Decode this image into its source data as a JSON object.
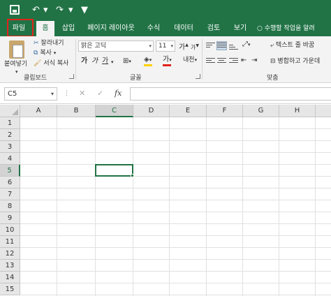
{
  "quick_access": {
    "save_icon": "save-icon",
    "undo_icon": "undo-icon",
    "redo_icon": "redo-icon",
    "undo_glyph": "↶",
    "redo_glyph": "↷",
    "dropdown_glyph": "▾",
    "customize_glyph": "▼"
  },
  "tabs": [
    {
      "label": "파일",
      "active": false
    },
    {
      "label": "홈",
      "active": true
    },
    {
      "label": "삽입",
      "active": false
    },
    {
      "label": "페이지 레이아웃",
      "active": false
    },
    {
      "label": "수식",
      "active": false
    },
    {
      "label": "데이터",
      "active": false
    },
    {
      "label": "검토",
      "active": false
    },
    {
      "label": "보기",
      "active": false
    }
  ],
  "tell_me": {
    "icon": "lightbulb-icon",
    "glyph": "💡",
    "placeholder": "수행할 작업을 알려"
  },
  "ribbon": {
    "clipboard": {
      "paste_label": "붙여넣기",
      "cut_label": "잘라내기",
      "copy_label": "복사",
      "copy_dropdown": "▾",
      "format_painter_label": "서식 복사",
      "group_label": "클립보드"
    },
    "font": {
      "font_name": "맑은 고딕",
      "font_size": "11",
      "grow_label": "가",
      "shrink_label": "가",
      "bold_label": "가",
      "italic_label": "가",
      "underline_label": "가",
      "font_color_label": "가",
      "phonetic_label": "내천",
      "fill_color": "#ffd200",
      "font_color": "#e0241c",
      "group_label": "글꼴"
    },
    "alignment": {
      "wrap_text_label": "텍스트 줄 바꿈",
      "merge_center_label": "병합하고 가운데",
      "group_label": "맞춤"
    }
  },
  "formula_bar": {
    "name_box": "C5",
    "cancel_glyph": "✕",
    "enter_glyph": "✓",
    "fx_label": "fx",
    "formula": ""
  },
  "grid": {
    "columns": [
      "A",
      "B",
      "C",
      "D",
      "E",
      "F",
      "G",
      "H"
    ],
    "rows": [
      "1",
      "2",
      "3",
      "4",
      "5",
      "6",
      "7",
      "8",
      "9",
      "10",
      "11",
      "12",
      "13",
      "14",
      "15"
    ],
    "active_column": "C",
    "active_row": "5"
  },
  "colors": {
    "accent": "#217346",
    "highlight_box": "#e0241c"
  }
}
